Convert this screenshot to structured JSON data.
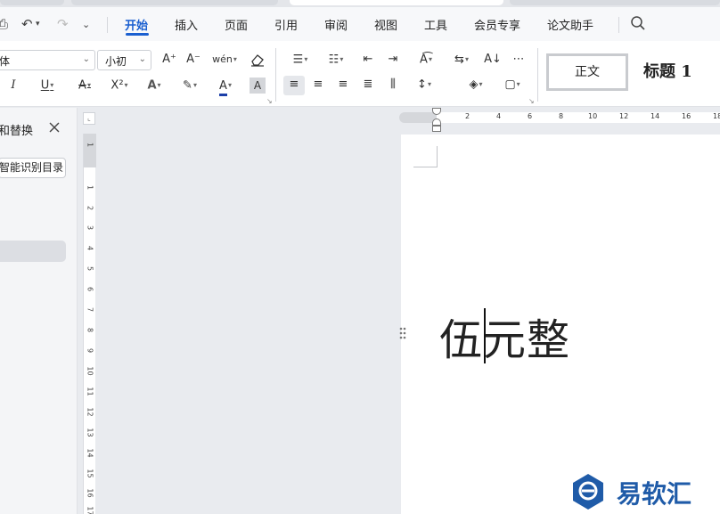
{
  "menu": {
    "items": [
      "开始",
      "插入",
      "页面",
      "引用",
      "审阅",
      "视图",
      "工具",
      "会员专享",
      "论文助手"
    ],
    "active": "开始"
  },
  "ribbon": {
    "font_name": "体",
    "font_size": "小初",
    "grow_font": "A⁺",
    "shrink_font": "A⁻",
    "phonetic": "wén",
    "superscript": "X²",
    "style_normal": "正文",
    "style_heading": "标题 1"
  },
  "panel": {
    "title": "和替换",
    "smart_toc_button": "智能识别目录"
  },
  "rulers": {
    "horizontal": [
      "2",
      "4",
      "6",
      "8",
      "10",
      "12",
      "14",
      "16",
      "18"
    ],
    "vertical": [
      "1",
      "1",
      "2",
      "3",
      "4",
      "5",
      "6",
      "7",
      "8",
      "9",
      "10",
      "11",
      "12",
      "13",
      "14",
      "15",
      "16",
      "17"
    ]
  },
  "document": {
    "text": "伍元整"
  },
  "watermark": {
    "text": "易软汇"
  },
  "colors": {
    "accent": "#1a5fd0",
    "font_color_bar": "#1c3fa8",
    "watermark": "#1f5ba8"
  }
}
